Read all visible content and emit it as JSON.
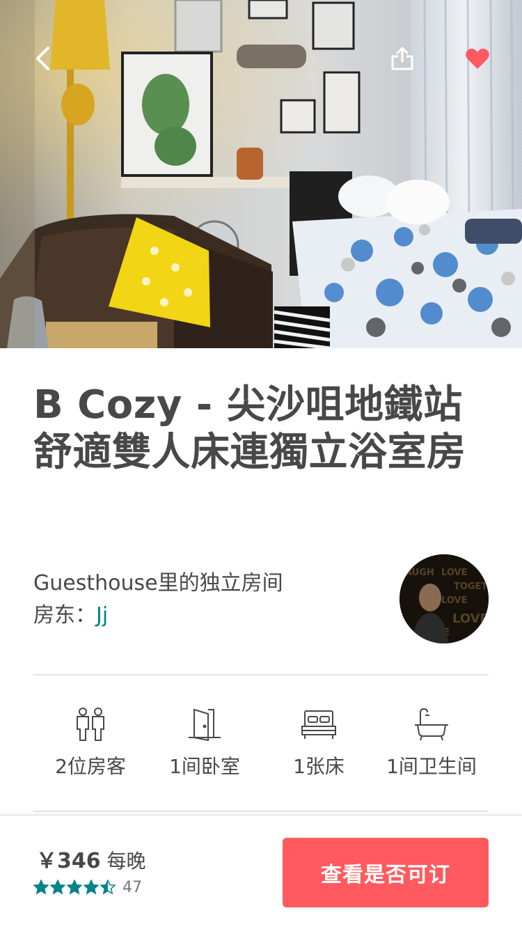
{
  "listing": {
    "title": "B Cozy - 尖沙咀地鐵站舒適雙人床連獨立浴室房",
    "room_type": "Guesthouse里的独立房间",
    "host_label": "房东：",
    "host_name": "Jj"
  },
  "amenities": [
    {
      "icon": "guests-icon",
      "label": "2位房客"
    },
    {
      "icon": "door-icon",
      "label": "1间卧室"
    },
    {
      "icon": "bed-icon",
      "label": "1张床"
    },
    {
      "icon": "bathtub-icon",
      "label": "1间卫生间"
    }
  ],
  "footer": {
    "price_amount": "￥346",
    "price_unit": "每晚",
    "rating": 4.5,
    "review_count": "47",
    "book_label": "查看是否可订"
  },
  "colors": {
    "brand": "#ff5a5f",
    "teal": "#008489",
    "text": "#484848",
    "heart": "#ff5a5f"
  }
}
